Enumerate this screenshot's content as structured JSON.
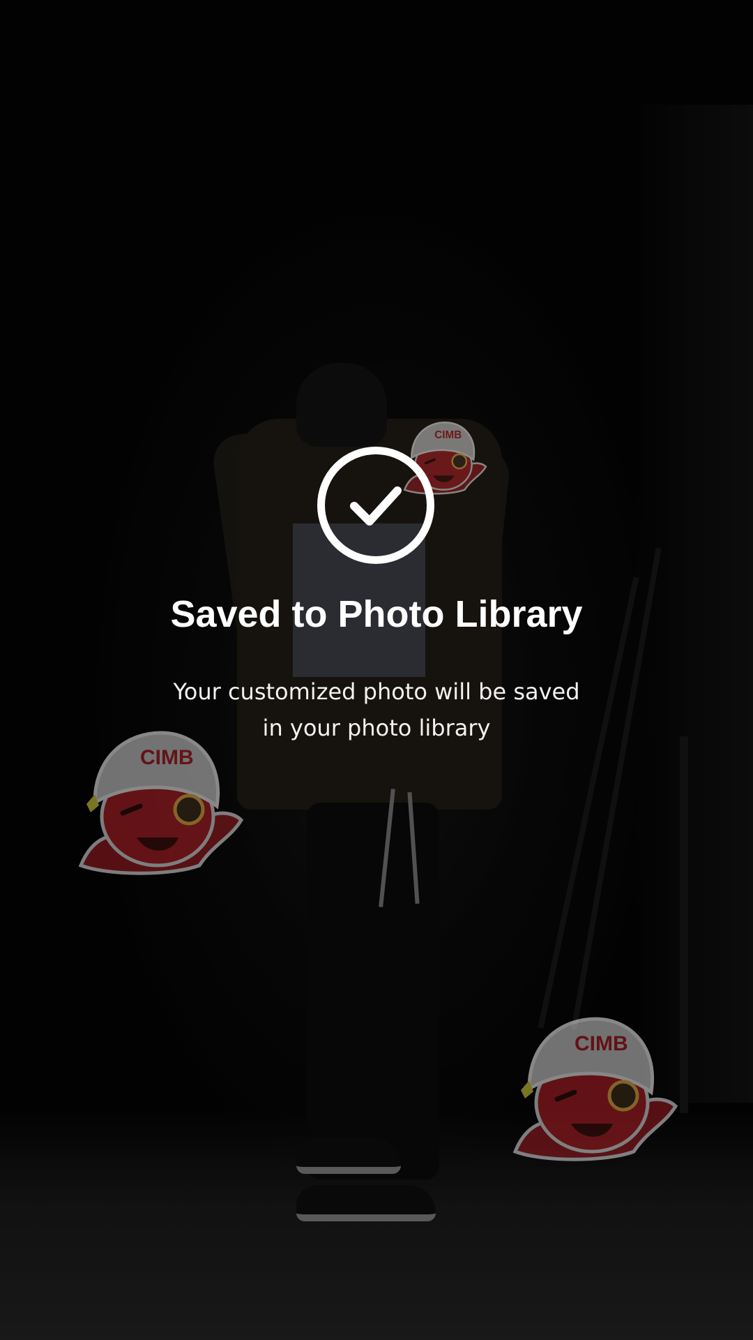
{
  "dialog": {
    "icon": "checkmark-circle-icon",
    "title": "Saved to Photo Library",
    "message_lines": [
      "Your customized photo will be saved",
      "in your photo library"
    ]
  },
  "stickers": {
    "brand_text": "CIMB",
    "mascot": "octopus-mascot"
  },
  "colors": {
    "text": "#ffffff",
    "mascot_red": "#a31d24",
    "helmet_grey": "#bdbdbd"
  }
}
